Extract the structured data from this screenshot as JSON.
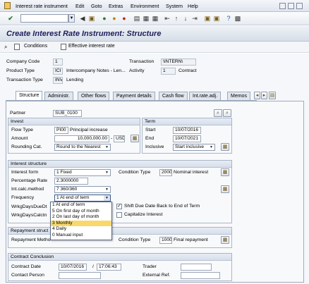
{
  "menu": {
    "items": [
      "Interest rate instrument",
      "Edit",
      "Goto",
      "Extras",
      "Environment",
      "System",
      "Help"
    ]
  },
  "title": "Create Interest Rate Instrument: Structure",
  "app_toolbar": {
    "conditions_label": "Conditions",
    "effective_rate_label": "Effective interest rate"
  },
  "header": {
    "company_code_label": "Company Code",
    "company_code_value": "1",
    "product_type_label": "Product Type",
    "product_type_value": "ICI",
    "product_type_text": "Intercompany Notes - Len...",
    "transaction_type_label": "Transaction Type",
    "transaction_type_value": "INV",
    "transaction_type_text": "Lending",
    "transaction_label": "Transaction",
    "transaction_value": "\\INTERN\\",
    "activity_label": "Activity",
    "activity_value": "1",
    "activity_text": "Contract"
  },
  "tabs": [
    "Structure",
    "Administr.",
    "Other flows",
    "Payment details",
    "Cash flow",
    "Int.rate.adj.",
    "Memos"
  ],
  "partner": {
    "label": "Partner",
    "value": "SUB_0100"
  },
  "invest": {
    "title": "Invest",
    "flow_type_label": "Flow Type",
    "flow_type_value": "PI00",
    "flow_type_text": "Principal increase",
    "amount_label": "Amount",
    "amount_value": "10,000,000.00",
    "currency_value": "USD",
    "rounding_label": "Rounding Cat.",
    "rounding_value": "Round to the Nearest"
  },
  "term": {
    "title": "Term",
    "start_label": "Start",
    "start_value": "10/07/2016",
    "end_label": "End",
    "end_value": "10/07/2021",
    "inclusive_label": "Inclusive",
    "inclusive_value": "Start inclusive"
  },
  "interest": {
    "title": "Interest structure",
    "form_label": "Interest form",
    "form_value": "1 Fixed",
    "condition_type_label": "Condition Type",
    "condition_type_value": "2000",
    "condition_type_text": "Nominal interest",
    "rate_label": "Percentage Rate",
    "rate_value": "2.3000000",
    "calc_label": "Int.calc.method",
    "calc_value": "7 360/360",
    "frequency_label": "Frequency",
    "frequency_value": "1 At end of term",
    "wrkdays_due_label": "WrkgDaysDueDt",
    "wrkdays_calc_label": "WrkgDaysCalctn",
    "shift_label": "Shift Due Date Back to End of Term",
    "capitalize_label": "Capitalize Interest"
  },
  "frequency_options": [
    "1 At end of term",
    "5 On first day of month",
    "2 On last day of month",
    "3 Monthly",
    "4 Daily",
    "0 Manual input"
  ],
  "frequency_selected_index": 3,
  "repayment": {
    "title": "Repayment struct",
    "method_label": "Repayment Metho",
    "condition_type_label": "Condition Type",
    "condition_type_value": "1000",
    "condition_type_text": "Final repayment"
  },
  "conclusion": {
    "title": "Contract Conclusion",
    "date_label": "Contract Date",
    "date_value": "10/07/2016",
    "time_value": "17:06:43",
    "trader_label": "Trader",
    "contact_label": "Contact Person",
    "external_ref_label": "External Ref."
  },
  "colors": {
    "title_text": "#1e1e5a",
    "selected_option": "#f8d86a",
    "frame": "#aab6c6"
  }
}
